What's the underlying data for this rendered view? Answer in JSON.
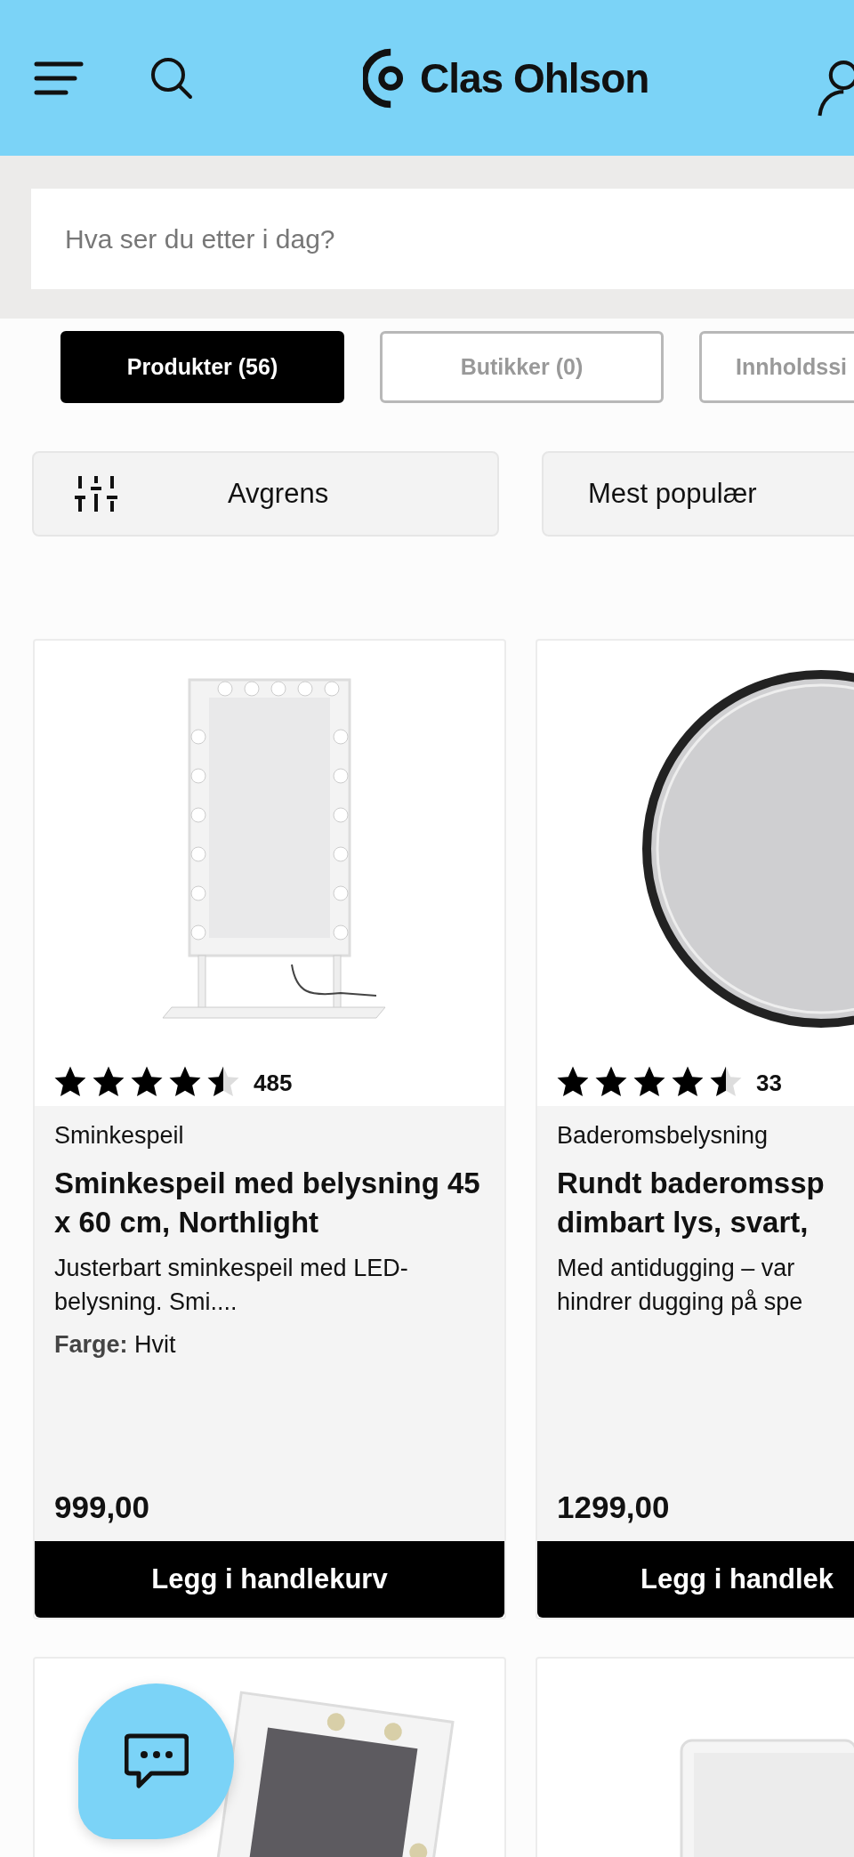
{
  "header": {
    "logo": "Clas Ohlson"
  },
  "search": {
    "placeholder": "Hva ser du etter i dag?"
  },
  "tabs": [
    {
      "label": "Produkter (56)",
      "selected": true
    },
    {
      "label": "Butikker (0)",
      "selected": false
    },
    {
      "label": "Innholdssi",
      "selected": false
    }
  ],
  "filters": {
    "refine": "Avgrens",
    "sort": "Mest populær"
  },
  "products": [
    {
      "kind": "vanity",
      "stars": 4.5,
      "reviews": "485",
      "category": "Sminkespeil",
      "title": "Sminkespeil med belysning 45 x 60 cm, Northlight",
      "description": "Justerbart sminkespeil med LED-belysning. Smi....",
      "color_label": "Farge:",
      "color_value": "Hvit",
      "price": "999,00",
      "button": "Legg i handlekurv"
    },
    {
      "kind": "round",
      "stars": 4.5,
      "reviews": "33",
      "category": "Baderomsbelysning",
      "title": "Rundt baderomssp\ndimbart lys, svart,",
      "description": "Med antidugging – var\nhindrer dugging på spe",
      "price": "1299,00",
      "button": "Legg i handlek"
    }
  ]
}
